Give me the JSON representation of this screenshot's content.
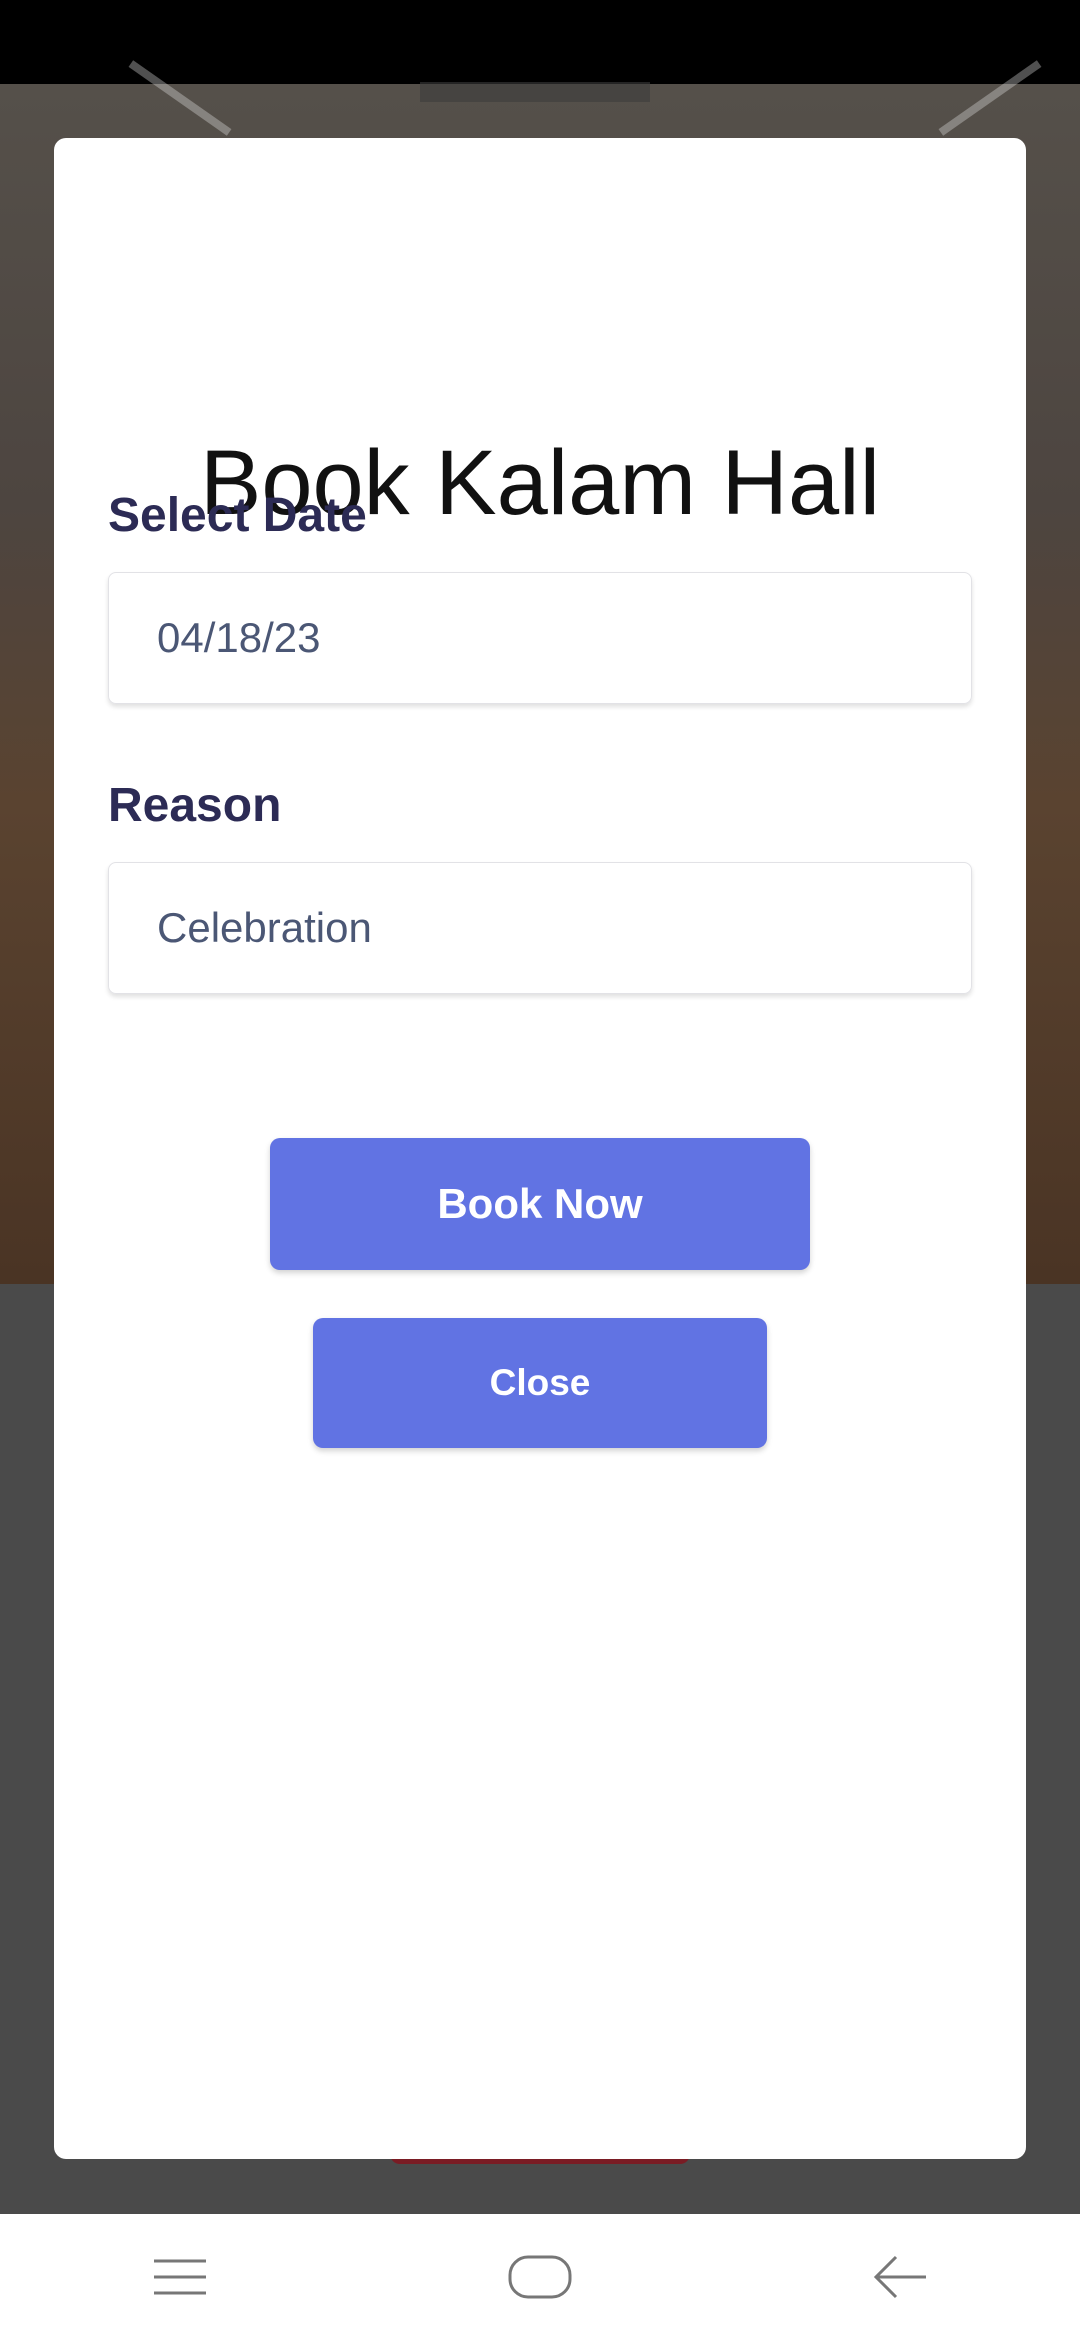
{
  "modal": {
    "title": "Book Kalam Hall",
    "date_label": "Select Date",
    "date_value": "04/18/23",
    "reason_label": "Reason",
    "reason_value": "Celebration",
    "book_button": "Book Now",
    "close_button": "Close"
  },
  "nav": {
    "items": [
      {
        "icon": "menu-icon"
      },
      {
        "icon": "home-icon"
      },
      {
        "icon": "back-icon"
      }
    ]
  },
  "colors": {
    "accent": "#6173e3",
    "label": "#2c2b55",
    "field_text": "#4b5775"
  }
}
